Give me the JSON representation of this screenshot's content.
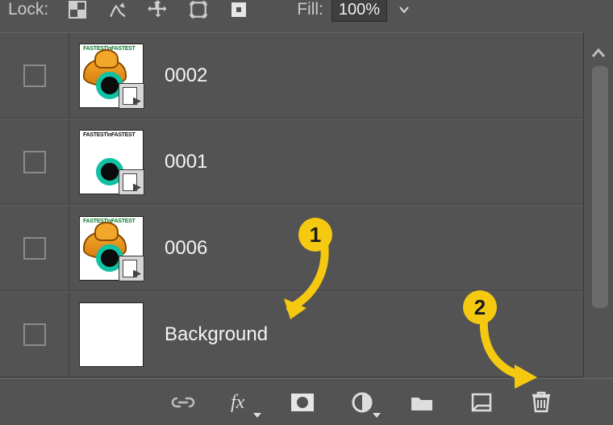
{
  "toprow": {
    "lock_label": "Lock:",
    "fill_label": "Fill:",
    "fill_value": "100%"
  },
  "layers": [
    {
      "name": "0002",
      "thumb": "hat+circ",
      "smart": true
    },
    {
      "name": "0001",
      "thumb": "circ",
      "smart": true
    },
    {
      "name": "0006",
      "thumb": "hat+circ",
      "smart": true
    },
    {
      "name": "Background",
      "thumb": "blank",
      "smart": false
    }
  ],
  "callouts": {
    "c1": "1",
    "c2": "2"
  }
}
